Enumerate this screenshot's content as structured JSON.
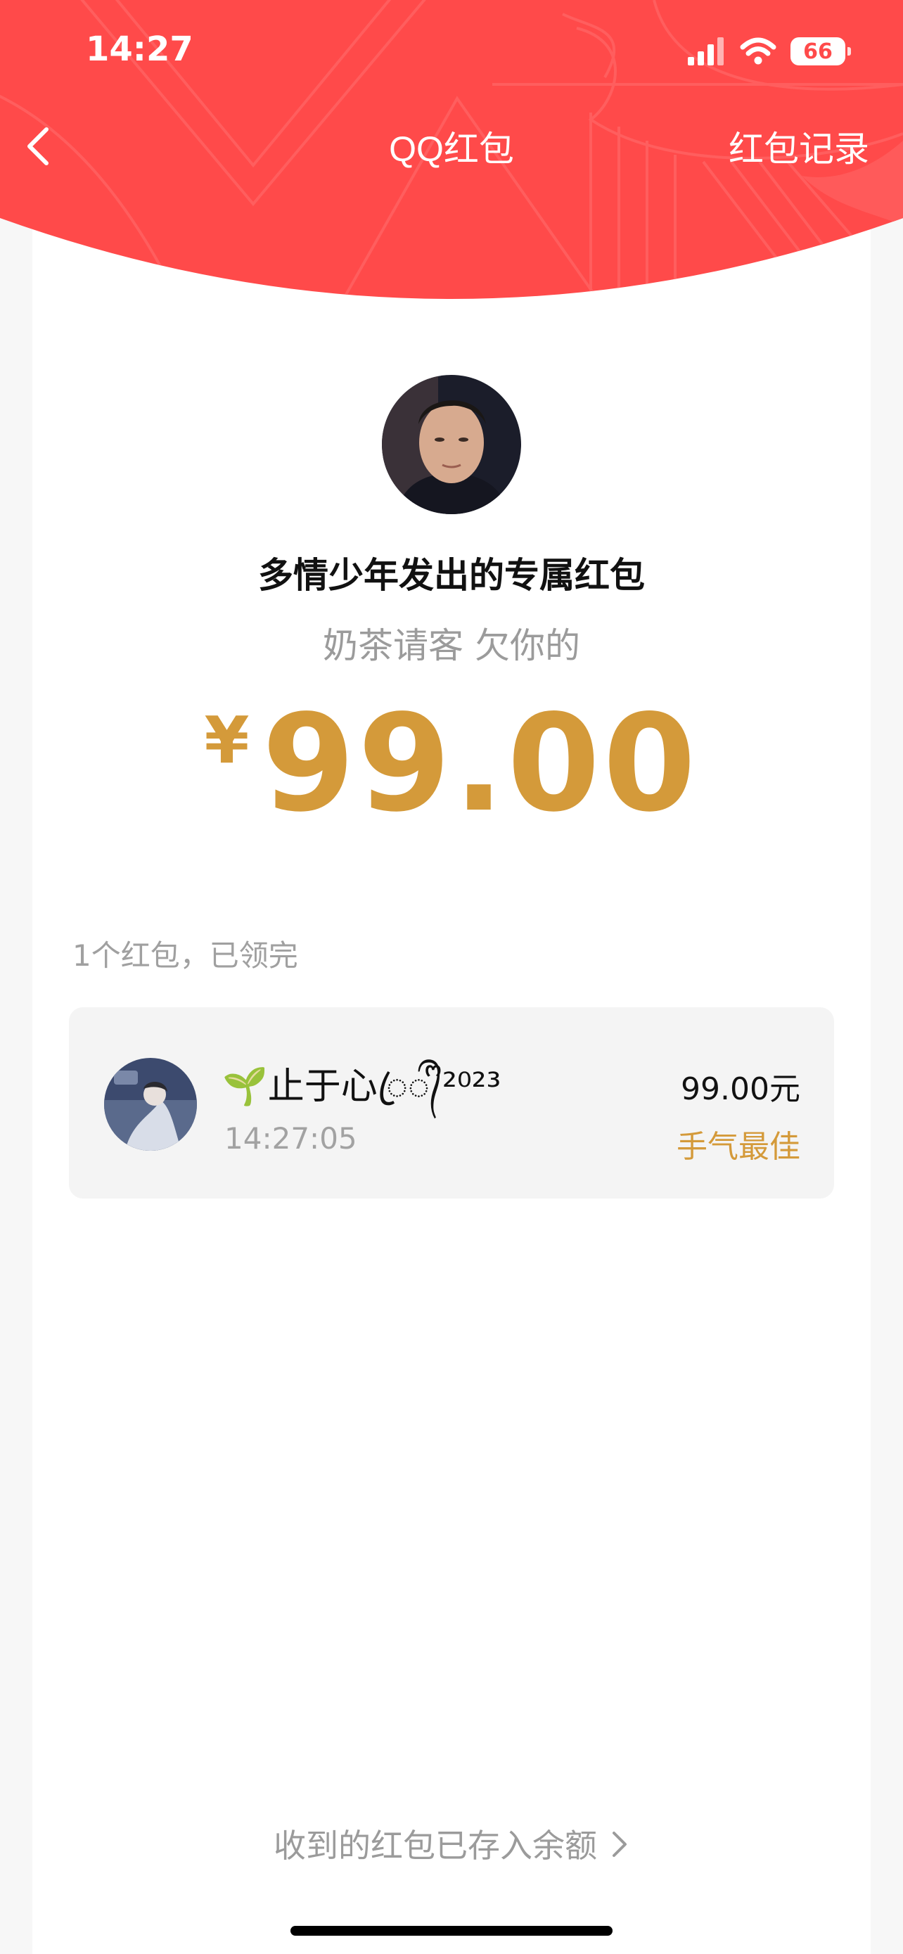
{
  "status_bar": {
    "time": "14:27",
    "battery": "66"
  },
  "nav": {
    "title": "QQ红包",
    "right_action": "红包记录"
  },
  "packet": {
    "sender_title": "多情少年发出的专属红包",
    "memo": "奶茶请客 欠你的",
    "currency": "¥",
    "amount": "99.00"
  },
  "claims": {
    "status": "1个红包，已领完",
    "records": [
      {
        "name": "🌱止于心ꦿ᭄ᩚ²⁰²³",
        "time": "14:27:05",
        "amount": "99.00元",
        "tag": "手气最佳"
      }
    ]
  },
  "footer": {
    "link": "收到的红包已存入余额"
  },
  "colors": {
    "header_red": "#ff4a4a",
    "amount_gold": "#d49a3a"
  }
}
